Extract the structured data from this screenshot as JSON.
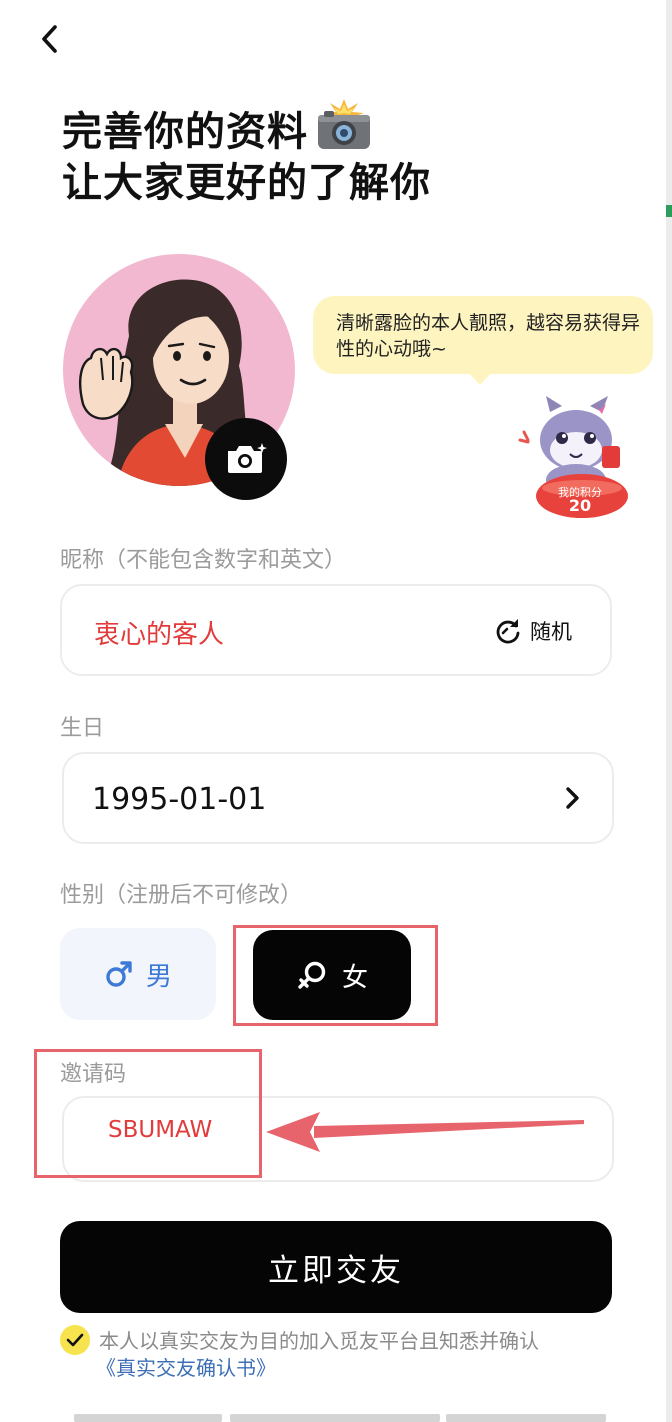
{
  "header": {
    "title_line1": "完善你的资料",
    "title_line2": "让大家更好的了解你"
  },
  "avatar": {
    "camera_icon": "camera-icon"
  },
  "tip": {
    "text": "清晰露脸的本人靓照，越容易获得异性的心动哦~"
  },
  "points": {
    "label": "我的积分",
    "value": "20"
  },
  "nickname": {
    "label": "昵称（不能包含数字和英文）",
    "value": "衷心的客人",
    "random_label": "随机"
  },
  "birthday": {
    "label": "生日",
    "value": "1995-01-01"
  },
  "gender": {
    "label": "性别（注册后不可修改）",
    "male_label": "男",
    "female_label": "女",
    "selected": "女"
  },
  "invite": {
    "label": "邀请码",
    "value": "SBUMAW"
  },
  "submit": {
    "label": "立即交友"
  },
  "agreement": {
    "text": "本人以真实交友为目的加入觅友平台且知悉并确认",
    "link": "《真实交友确认书》",
    "checked": true
  },
  "colors": {
    "accent_red": "#e23b3b",
    "highlight_red": "#e8646d",
    "male_blue": "#3d7ad6",
    "tip_yellow": "#fdf4c0",
    "check_yellow": "#f7e34d"
  }
}
